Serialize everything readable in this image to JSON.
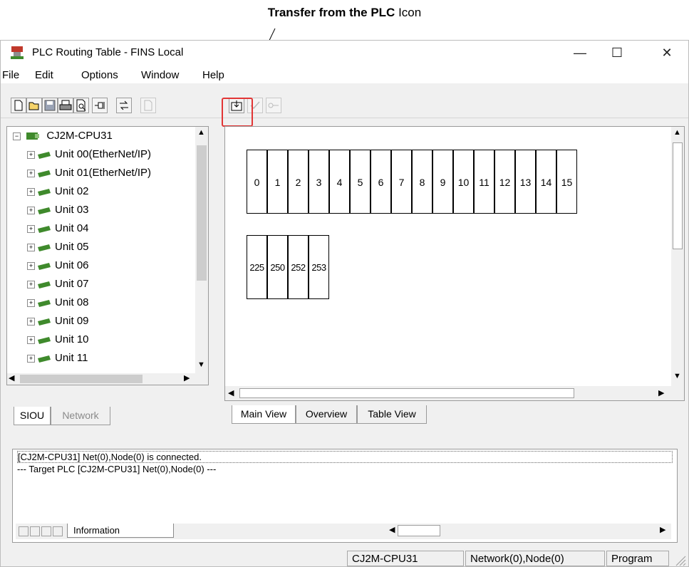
{
  "callout": {
    "bold": "Transfer from the PLC",
    "suffix": "Icon"
  },
  "window": {
    "title": "PLC Routing Table - FINS Local",
    "minimize": "—",
    "maximize": "☐",
    "close": "✕"
  },
  "menu": [
    "File",
    "Edit",
    "Options",
    "Window",
    "Help"
  ],
  "toolbar": {
    "buttons": [
      "new-icon",
      "open-icon",
      "save-icon",
      "print-icon",
      "print-preview-icon",
      "pin-icon",
      "routing-icon",
      "disabled-doc-icon",
      "transfer-from-plc-icon",
      "check-icon",
      "key-icon"
    ]
  },
  "tree": {
    "root": "CJ2M-CPU31",
    "units": [
      "Unit 00(EtherNet/IP)",
      "Unit 01(EtherNet/IP)",
      "Unit 02",
      "Unit 03",
      "Unit 04",
      "Unit 05",
      "Unit 06",
      "Unit 07",
      "Unit 08",
      "Unit 09",
      "Unit 10",
      "Unit 11"
    ]
  },
  "left_tabs": {
    "siou": "SIOU",
    "network": "Network"
  },
  "view": {
    "slots": [
      "0",
      "1",
      "2",
      "3",
      "4",
      "5",
      "6",
      "7",
      "8",
      "9",
      "10",
      "11",
      "12",
      "13",
      "14",
      "15"
    ],
    "networks": [
      "225",
      "250",
      "252",
      "253"
    ]
  },
  "view_tabs": {
    "main": "Main View",
    "overview": "Overview",
    "table": "Table View"
  },
  "info": {
    "lines": [
      "[CJ2M-CPU31] Net(0),Node(0) is connected.",
      "--- Target PLC [CJ2M-CPU31] Net(0),Node(0) ---"
    ],
    "tab": "Information"
  },
  "status": {
    "plc": "CJ2M-CPU31",
    "node": "Network(0),Node(0)",
    "mode": "Program"
  },
  "colors": {
    "highlight": "#e23535",
    "node_green": "#3f8a2c"
  }
}
